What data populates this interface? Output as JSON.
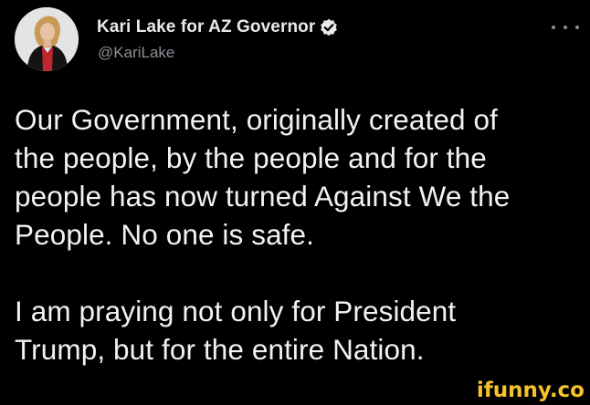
{
  "author": {
    "display_name": "Kari Lake for AZ Governor",
    "handle": "@KariLake",
    "verified_icon": "verified-badge-icon",
    "verified_color": "#e7e9ea"
  },
  "menu": {
    "more_icon": "more-horizontal-icon"
  },
  "tweet": {
    "lines": [
      "Our Government, originally created of",
      "the people, by the people and for the",
      "people has now turned Against We the",
      "People. No one is safe."
    ],
    "lines2": [
      "I am praying not only for President",
      "Trump, but for the entire Nation."
    ]
  },
  "watermark": {
    "text": "ifunny.co",
    "color": "#f6c42a"
  },
  "colors": {
    "background": "#000000",
    "text": "#f2f2f2",
    "secondary": "#8b9096"
  }
}
